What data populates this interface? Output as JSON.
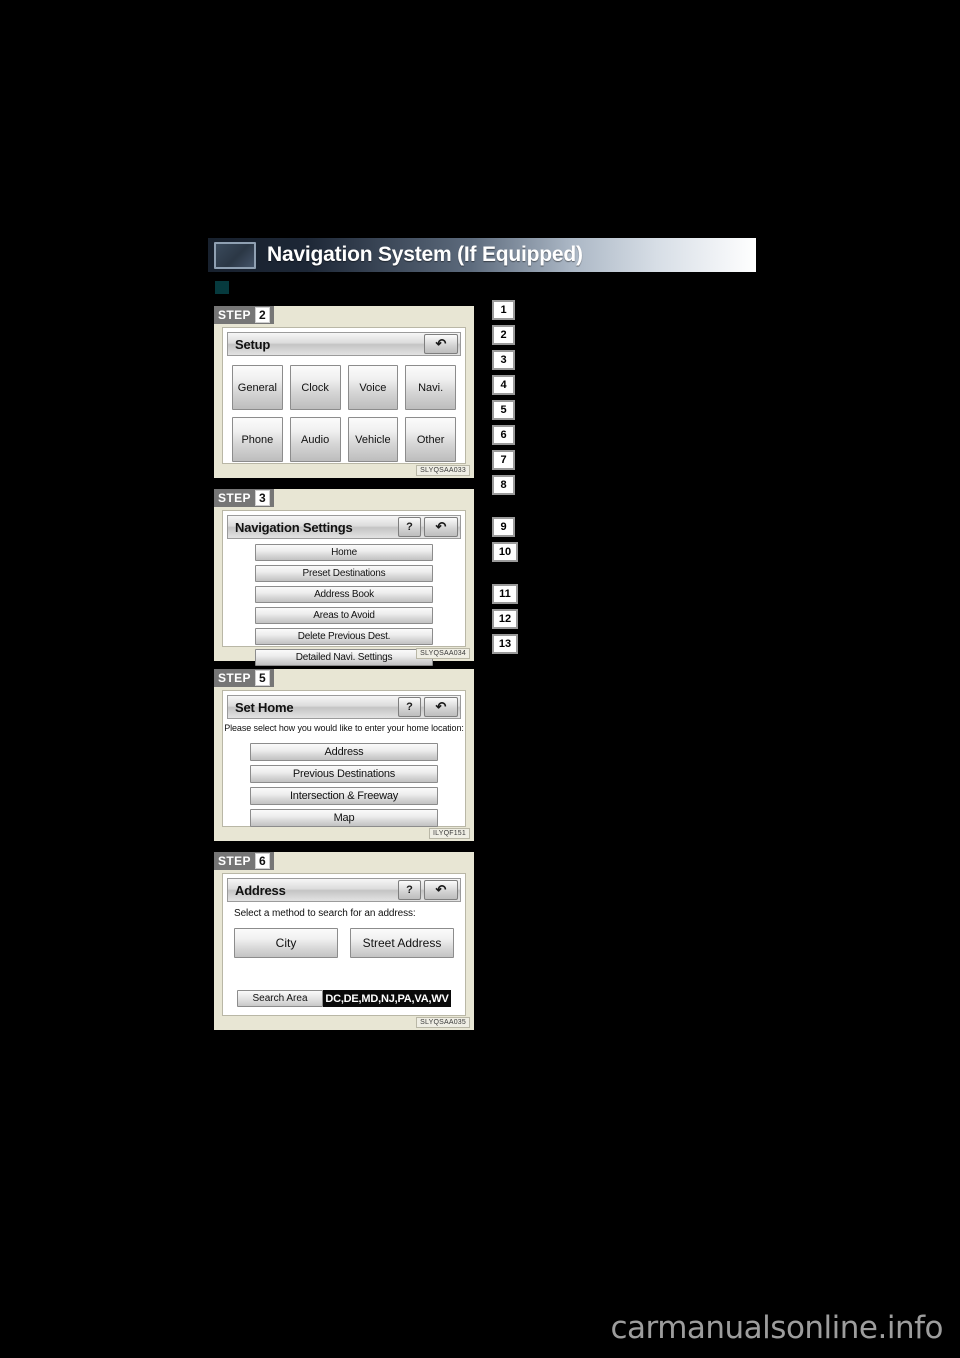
{
  "header": {
    "title": "Navigation System (If Equipped)",
    "icon": "display-screen-icon",
    "bullet": "section-bullet"
  },
  "panels": [
    {
      "step_word": "STEP",
      "step_number": "2",
      "figure_code": "SLYQSAA033",
      "screen": {
        "title": "Setup",
        "help_label": "?",
        "back_label": "↶",
        "has_help": false,
        "layout": "grid",
        "buttons": [
          "General",
          "Clock",
          "Voice",
          "Navi.",
          "Phone",
          "Audio",
          "Vehicle",
          "Other"
        ]
      }
    },
    {
      "step_word": "STEP",
      "step_number": "3",
      "figure_code": "SLYQSAA034",
      "screen": {
        "title": "Navigation Settings",
        "help_label": "?",
        "back_label": "↶",
        "has_help": true,
        "layout": "list",
        "buttons": [
          "Home",
          "Preset Destinations",
          "Address Book",
          "Areas to Avoid",
          "Delete Previous Dest.",
          "Detailed Navi. Settings"
        ]
      }
    },
    {
      "step_word": "STEP",
      "step_number": "5",
      "figure_code": "ILYQF151",
      "screen": {
        "title": "Set Home",
        "help_label": "?",
        "back_label": "↶",
        "has_help": true,
        "layout": "prompt-list",
        "prompt": "Please select how you would like to enter your home location:",
        "buttons": [
          "Address",
          "Previous Destinations",
          "Intersection & Freeway",
          "Map"
        ]
      }
    },
    {
      "step_word": "STEP",
      "step_number": "6",
      "figure_code": "SLYQSAA035",
      "screen": {
        "title": "Address",
        "help_label": "?",
        "back_label": "↶",
        "has_help": true,
        "layout": "address",
        "prompt": "Select a method to search for an address:",
        "buttons": [
          "City",
          "Street Address"
        ],
        "search_area_label": "Search Area",
        "search_area_value": "DC,DE,MD,NJ,PA,VA,WV"
      }
    }
  ],
  "markers_group_1": [
    "1",
    "2",
    "3",
    "4",
    "5",
    "6",
    "7",
    "8"
  ],
  "markers_group_2": [
    "9",
    "10"
  ],
  "markers_group_3": [
    "11",
    "12",
    "13"
  ],
  "watermark": "carmanualsonline.info"
}
